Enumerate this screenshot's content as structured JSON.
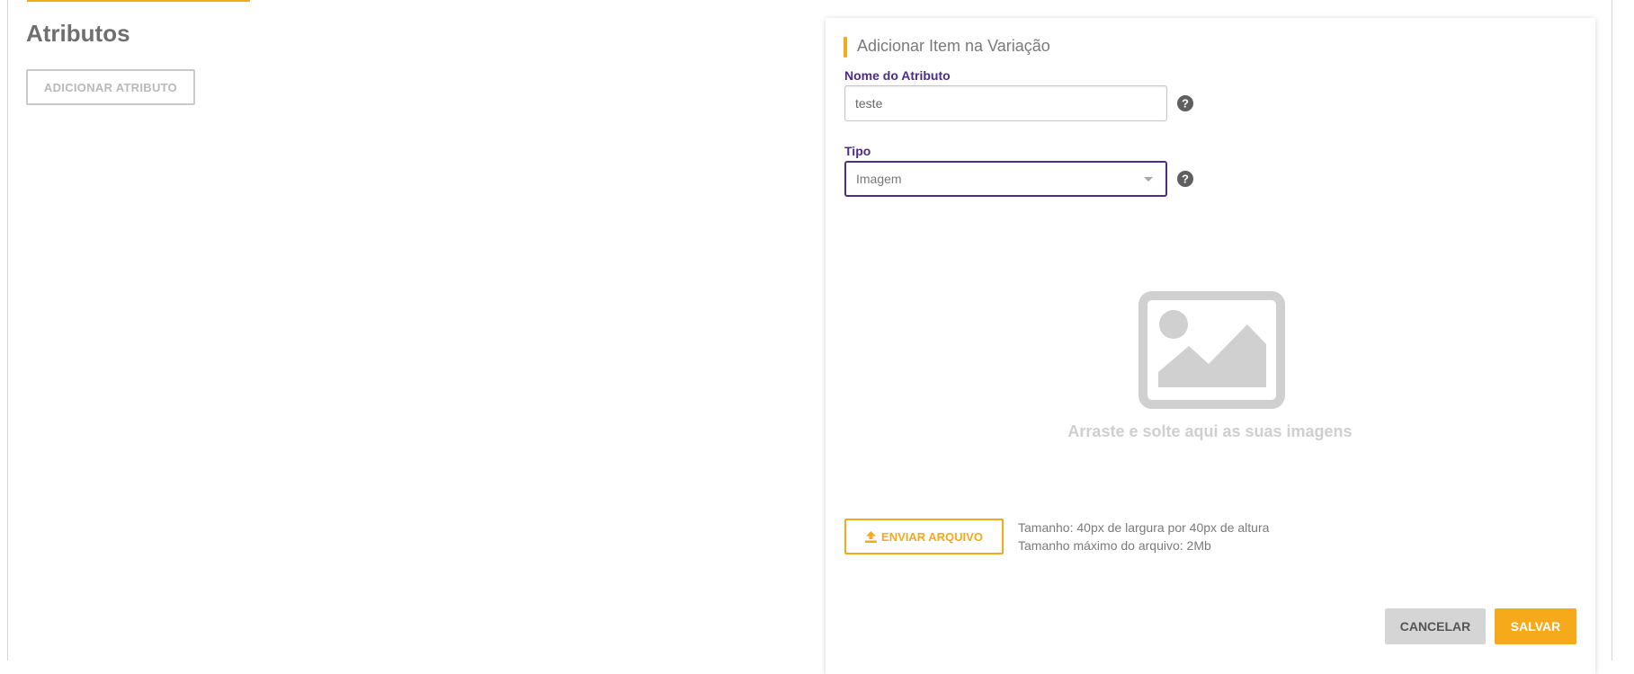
{
  "page": {
    "title": "Atributos",
    "add_attribute_label": "ADICIONAR ATRIBUTO"
  },
  "panel": {
    "title": "Adicionar Item na Variação",
    "name_field": {
      "label": "Nome do Atributo",
      "value": "teste"
    },
    "type_field": {
      "label": "Tipo",
      "selected": "Imagem"
    },
    "dropzone": {
      "text": "Arraste e solte aqui as suas imagens"
    },
    "upload": {
      "button_label": "ENVIAR ARQUIVO",
      "size_info": "Tamanho: 40px de largura por 40px de altura",
      "max_size_info": "Tamanho máximo do arquivo: 2Mb"
    },
    "actions": {
      "cancel_label": "CANCELAR",
      "save_label": "SALVAR"
    }
  },
  "icons": {
    "help": "question-circle-icon",
    "upload": "upload-icon",
    "placeholder": "image-placeholder-icon",
    "dropdown": "caret-down-icon"
  },
  "colors": {
    "accent": "#f5a91b",
    "label_purple": "#4b2c87",
    "muted_gray": "#d5d5d5"
  }
}
